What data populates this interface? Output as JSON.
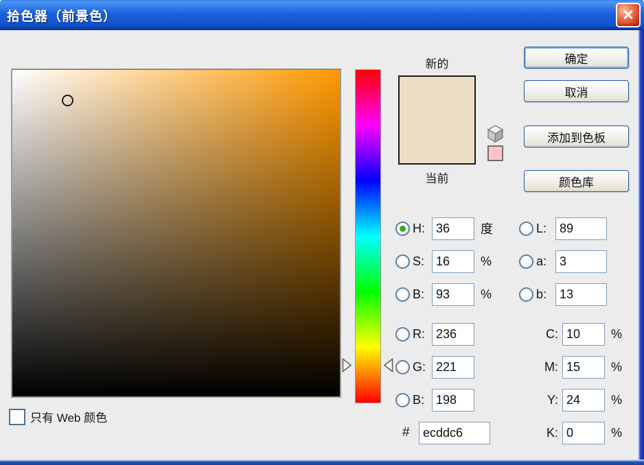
{
  "window": {
    "title": "拾色器（前景色）",
    "close_glyph": "✕"
  },
  "buttons": {
    "ok": "确定",
    "cancel": "取消",
    "add_to_swatches": "添加到色板",
    "color_libraries": "颜色库"
  },
  "preview": {
    "new_label": "新的",
    "current_label": "当前",
    "new_color": "#ecddc6",
    "current_color": "#ecddc6",
    "web_safe_color": "#ffc4c4"
  },
  "fields": {
    "hsb": [
      {
        "label": "H:",
        "value": "36",
        "unit": "度",
        "selected": true
      },
      {
        "label": "S:",
        "value": "16",
        "unit": "%",
        "selected": false
      },
      {
        "label": "B:",
        "value": "93",
        "unit": "%",
        "selected": false
      }
    ],
    "rgb": [
      {
        "label": "R:",
        "value": "236",
        "selected": false
      },
      {
        "label": "G:",
        "value": "221",
        "selected": false
      },
      {
        "label": "B:",
        "value": "198",
        "selected": false
      }
    ],
    "lab": [
      {
        "label": "L:",
        "value": "89",
        "selected": false
      },
      {
        "label": "a:",
        "value": "3",
        "selected": false
      },
      {
        "label": "b:",
        "value": "13",
        "selected": false
      }
    ],
    "cmyk": [
      {
        "label": "C:",
        "value": "10",
        "unit": "%"
      },
      {
        "label": "M:",
        "value": "15",
        "unit": "%"
      },
      {
        "label": "Y:",
        "value": "24",
        "unit": "%"
      },
      {
        "label": "K:",
        "value": "0",
        "unit": "%"
      }
    ],
    "hex": {
      "prefix": "#",
      "value": "ecddc6"
    }
  },
  "checkbox": {
    "label": "只有 Web 颜色",
    "checked": false
  },
  "picker_state": {
    "hue_degrees": 36,
    "saturation_percent": 16,
    "brightness_percent": 93,
    "pure_hue_color": "#ff9900"
  },
  "colors": {
    "titlebar_blue": "#1b5cd8",
    "frame_blue": "#2b4ad4",
    "dialog_bg": "#ececec",
    "input_border": "#7f9db9"
  }
}
